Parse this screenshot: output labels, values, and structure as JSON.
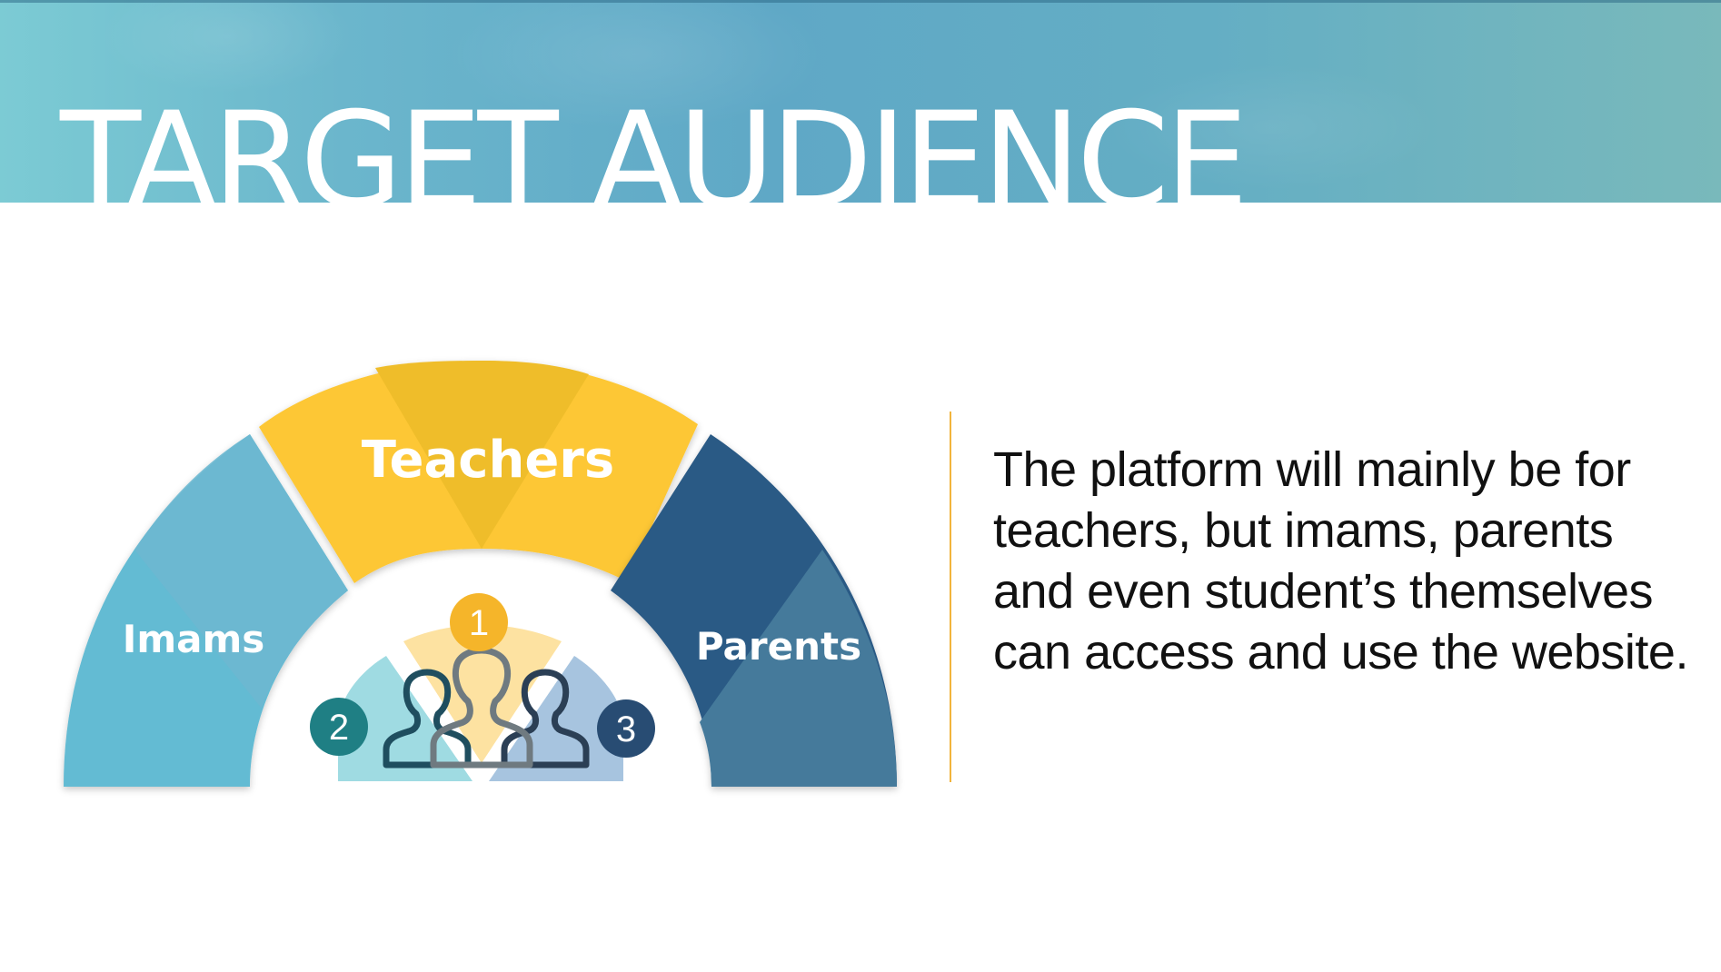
{
  "slide": {
    "title": "TARGET AUDIENCE",
    "description": "The platform will mainly be for teachers, but imams, parents and even student’s themselves can access and use the website."
  },
  "diagram": {
    "segments": [
      {
        "label": "Imams",
        "color": "#63bbd3"
      },
      {
        "label": "Teachers",
        "color": "#fdc734"
      },
      {
        "label": "Parents",
        "color": "#2c5a85"
      }
    ],
    "badges": [
      {
        "number": "1",
        "color": "#f5b52a"
      },
      {
        "number": "2",
        "color": "#1f7f84"
      },
      {
        "number": "3",
        "color": "#284c73"
      }
    ],
    "center_icon": "people-group-icon"
  },
  "colors": {
    "header_gradient_start": "#7ccbd4",
    "header_gradient_mid": "#5fa8c6",
    "divider": "#f2b43c",
    "text": "#111111"
  }
}
